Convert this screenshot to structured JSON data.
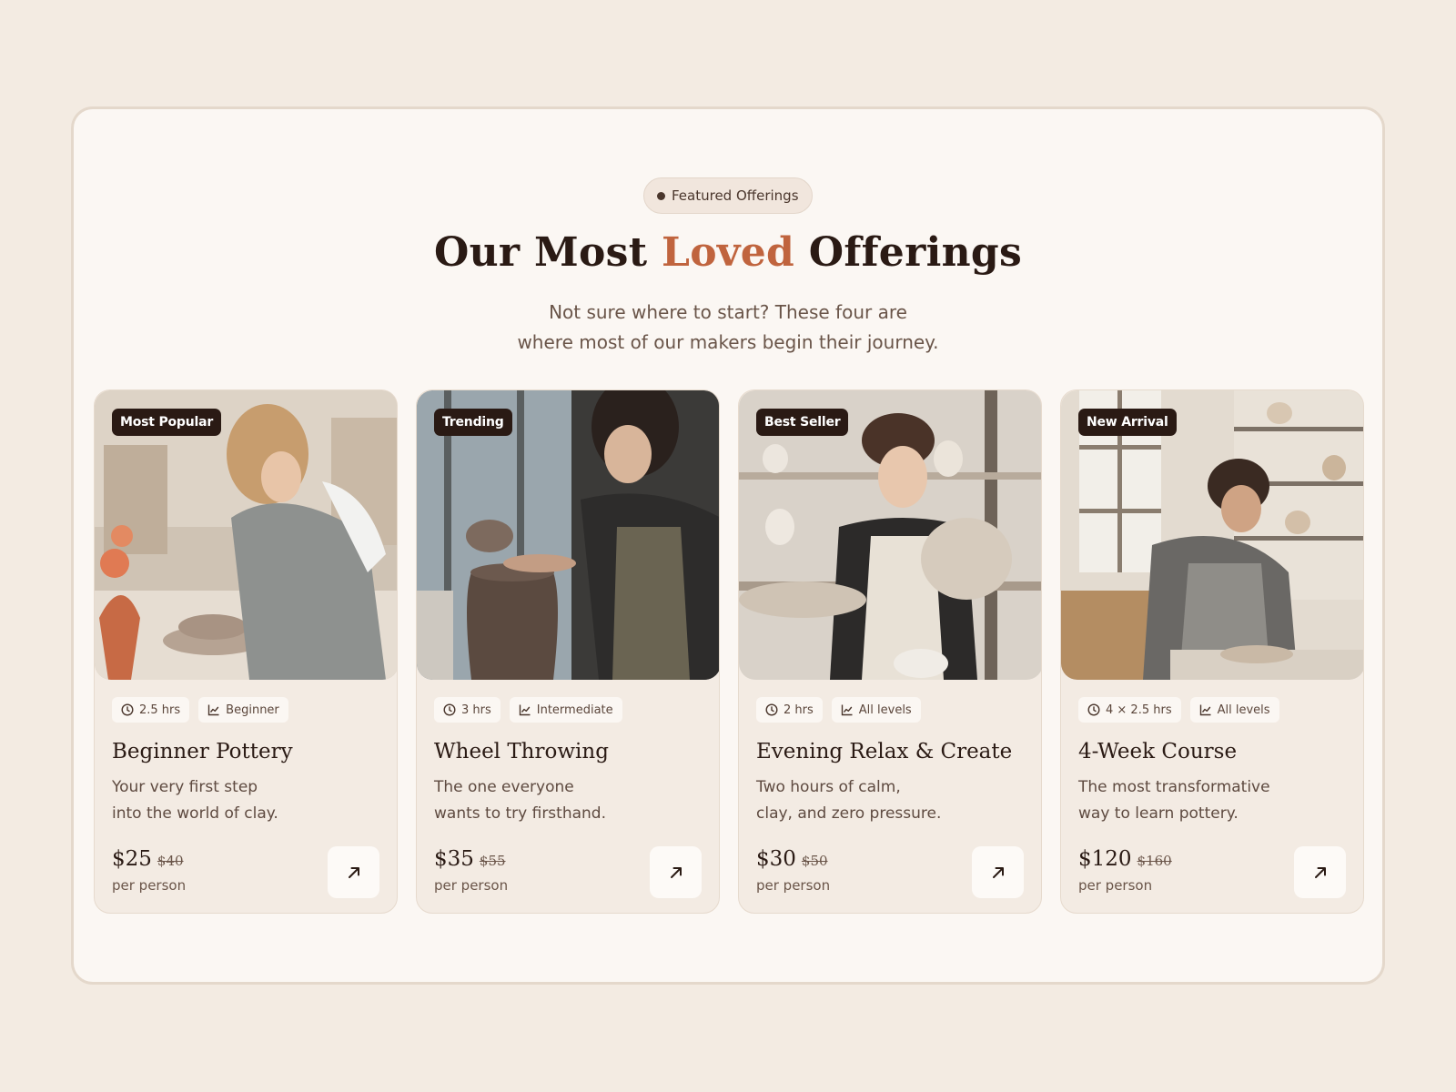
{
  "section": {
    "eyebrow": "Featured Offerings",
    "title_before": "Our Most ",
    "title_accent": "Loved",
    "title_after": " Offerings",
    "subtitle_line1": "Not sure where to start? These four are",
    "subtitle_line2": "where most of our makers begin their journey."
  },
  "colors": {
    "background": "#f3ebe2",
    "panel": "#fbf7f3",
    "accent": "#c0643e",
    "badge": "#2a1a14",
    "text_dark": "#2a1a14"
  },
  "icons": {
    "duration": "clock-icon",
    "level": "chart-line-icon",
    "action": "arrow-up-right-icon",
    "dot": "dot-icon"
  },
  "cards": [
    {
      "badge": "Most Popular",
      "duration": "2.5 hrs",
      "level": "Beginner",
      "title": "Beginner Pottery",
      "desc_line1": "Your very first step",
      "desc_line2": "into the world of clay.",
      "price": "$25",
      "old_price": "$40",
      "per": "per person"
    },
    {
      "badge": "Trending",
      "duration": "3 hrs",
      "level": "Intermediate",
      "title": "Wheel Throwing",
      "desc_line1": "The one everyone",
      "desc_line2": "wants to try firsthand.",
      "price": "$35",
      "old_price": "$55",
      "per": "per person"
    },
    {
      "badge": "Best Seller",
      "duration": "2 hrs",
      "level": "All levels",
      "title": "Evening Relax & Create",
      "desc_line1": "Two hours of calm,",
      "desc_line2": "clay, and zero pressure.",
      "price": "$30",
      "old_price": "$50",
      "per": "per person"
    },
    {
      "badge": "New Arrival",
      "duration": "4 × 2.5 hrs",
      "level": "All levels",
      "title": "4-Week Course",
      "desc_line1": "The most transformative",
      "desc_line2": "way to learn pottery.",
      "price": "$120",
      "old_price": "$160",
      "per": "per person"
    }
  ]
}
